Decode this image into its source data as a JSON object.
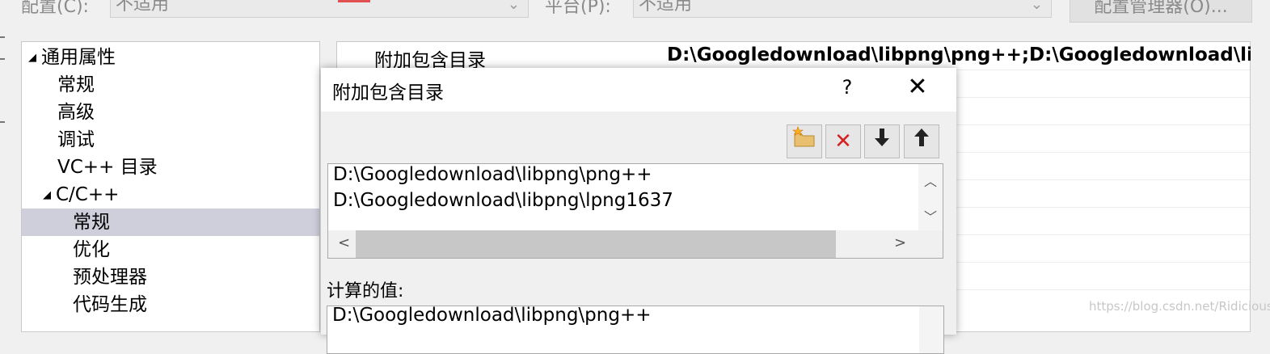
{
  "top_bar": {
    "config_label": "配置(C):",
    "config_value": "不适用",
    "platform_label": "平台(P):",
    "platform_value": "不适用",
    "manager_button": "配置管理器(O)..."
  },
  "tree": {
    "items": [
      {
        "label": "通用属性",
        "expanded": true
      },
      {
        "label": "常规"
      },
      {
        "label": "高级"
      },
      {
        "label": "调试"
      },
      {
        "label": "VC++ 目录"
      },
      {
        "label": "C/C++",
        "expanded": true
      },
      {
        "label": "常规",
        "selected": true
      },
      {
        "label": "优化"
      },
      {
        "label": "预处理器"
      },
      {
        "label": "代码生成"
      }
    ]
  },
  "grid": {
    "property_name": "附加包含目录",
    "property_value": "D:\\Googledownload\\libpng\\png++;D:\\Googledownload\\lib"
  },
  "dialog": {
    "title": "附加包含目录",
    "help": "?",
    "close": "✕",
    "list": [
      "D:\\Googledownload\\libpng\\png++",
      "D:\\Googledownload\\libpng\\lpng1637"
    ],
    "computed_label": "计算的值:",
    "computed_first": "D:\\Googledownload\\libpng\\png++"
  },
  "icons": {
    "new_folder": "new-folder-icon",
    "delete": "delete-icon",
    "move_down": "arrow-down-icon",
    "move_up": "arrow-up-icon"
  },
  "colors": {
    "selected_tree": "#cfcfdc",
    "delete_red": "#d62020"
  },
  "watermark": "https://blog.csdn.net/Ridicious"
}
